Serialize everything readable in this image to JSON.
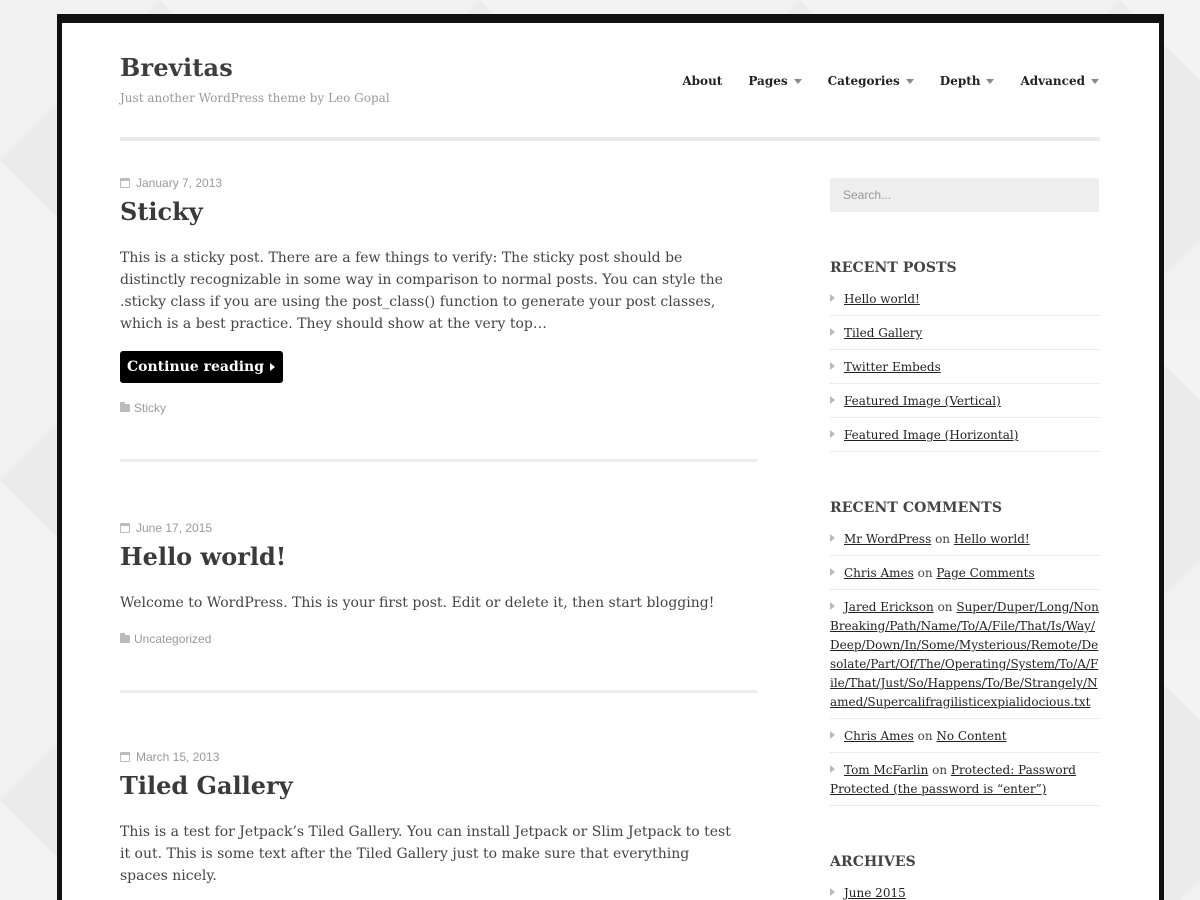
{
  "site": {
    "title": "Brevitas",
    "description": "Just another WordPress theme by Leo Gopal"
  },
  "nav": {
    "items": [
      {
        "label": "About",
        "dropdown": false
      },
      {
        "label": "Pages",
        "dropdown": true
      },
      {
        "label": "Categories",
        "dropdown": true
      },
      {
        "label": "Depth",
        "dropdown": true
      },
      {
        "label": "Advanced",
        "dropdown": true
      }
    ]
  },
  "posts": [
    {
      "date": "January 7, 2013",
      "title": "Sticky",
      "excerpt": "This is a sticky post. There are a few things to verify: The sticky post should be distinctly recognizable in some way in comparison to normal posts. You can style the .sticky class if you are using the post_class() function to generate your post classes, which is a best practice. They should show at the very top…",
      "button": "Continue reading",
      "category": "Sticky"
    },
    {
      "date": "June 17, 2015",
      "title": "Hello world!",
      "excerpt": "Welcome to WordPress. This is your first post. Edit or delete it, then start blogging!",
      "category": "Uncategorized"
    },
    {
      "date": "March 15, 2013",
      "title": "Tiled Gallery",
      "excerpt": "This is a test for Jetpack’s Tiled Gallery. You can install Jetpack or Slim Jetpack to test it out. This is some text after the Tiled Gallery just to make sure that everything spaces nicely."
    }
  ],
  "sidebar": {
    "search_placeholder": "Search...",
    "recent_posts": {
      "title": "RECENT POSTS",
      "items": [
        "Hello world!",
        "Tiled Gallery",
        "Twitter Embeds",
        "Featured Image (Vertical)",
        "Featured Image (Horizontal)"
      ]
    },
    "recent_comments": {
      "title": "RECENT COMMENTS",
      "connector": "on",
      "items": [
        {
          "author": "Mr WordPress",
          "post": "Hello world!"
        },
        {
          "author": "Chris Ames",
          "post": "Page Comments"
        },
        {
          "author": "Jared Erickson",
          "post": "Super/Duper/Long/NonBreaking/Path/Name/To/A/File/That/Is/Way/Deep/Down/In/Some/Mysterious/Remote/Desolate/Part/Of/The/Operating/System/To/A/File/That/Just/So/Happens/To/Be/Strangely/Named/Supercalifragilisticexpialidocious.txt"
        },
        {
          "author": "Chris Ames",
          "post": "No Content"
        },
        {
          "author": "Tom McFarlin",
          "post": "Protected: Password Protected (the password is “enter”)"
        }
      ]
    },
    "archives": {
      "title": "ARCHIVES",
      "items": [
        "June 2015"
      ]
    }
  }
}
